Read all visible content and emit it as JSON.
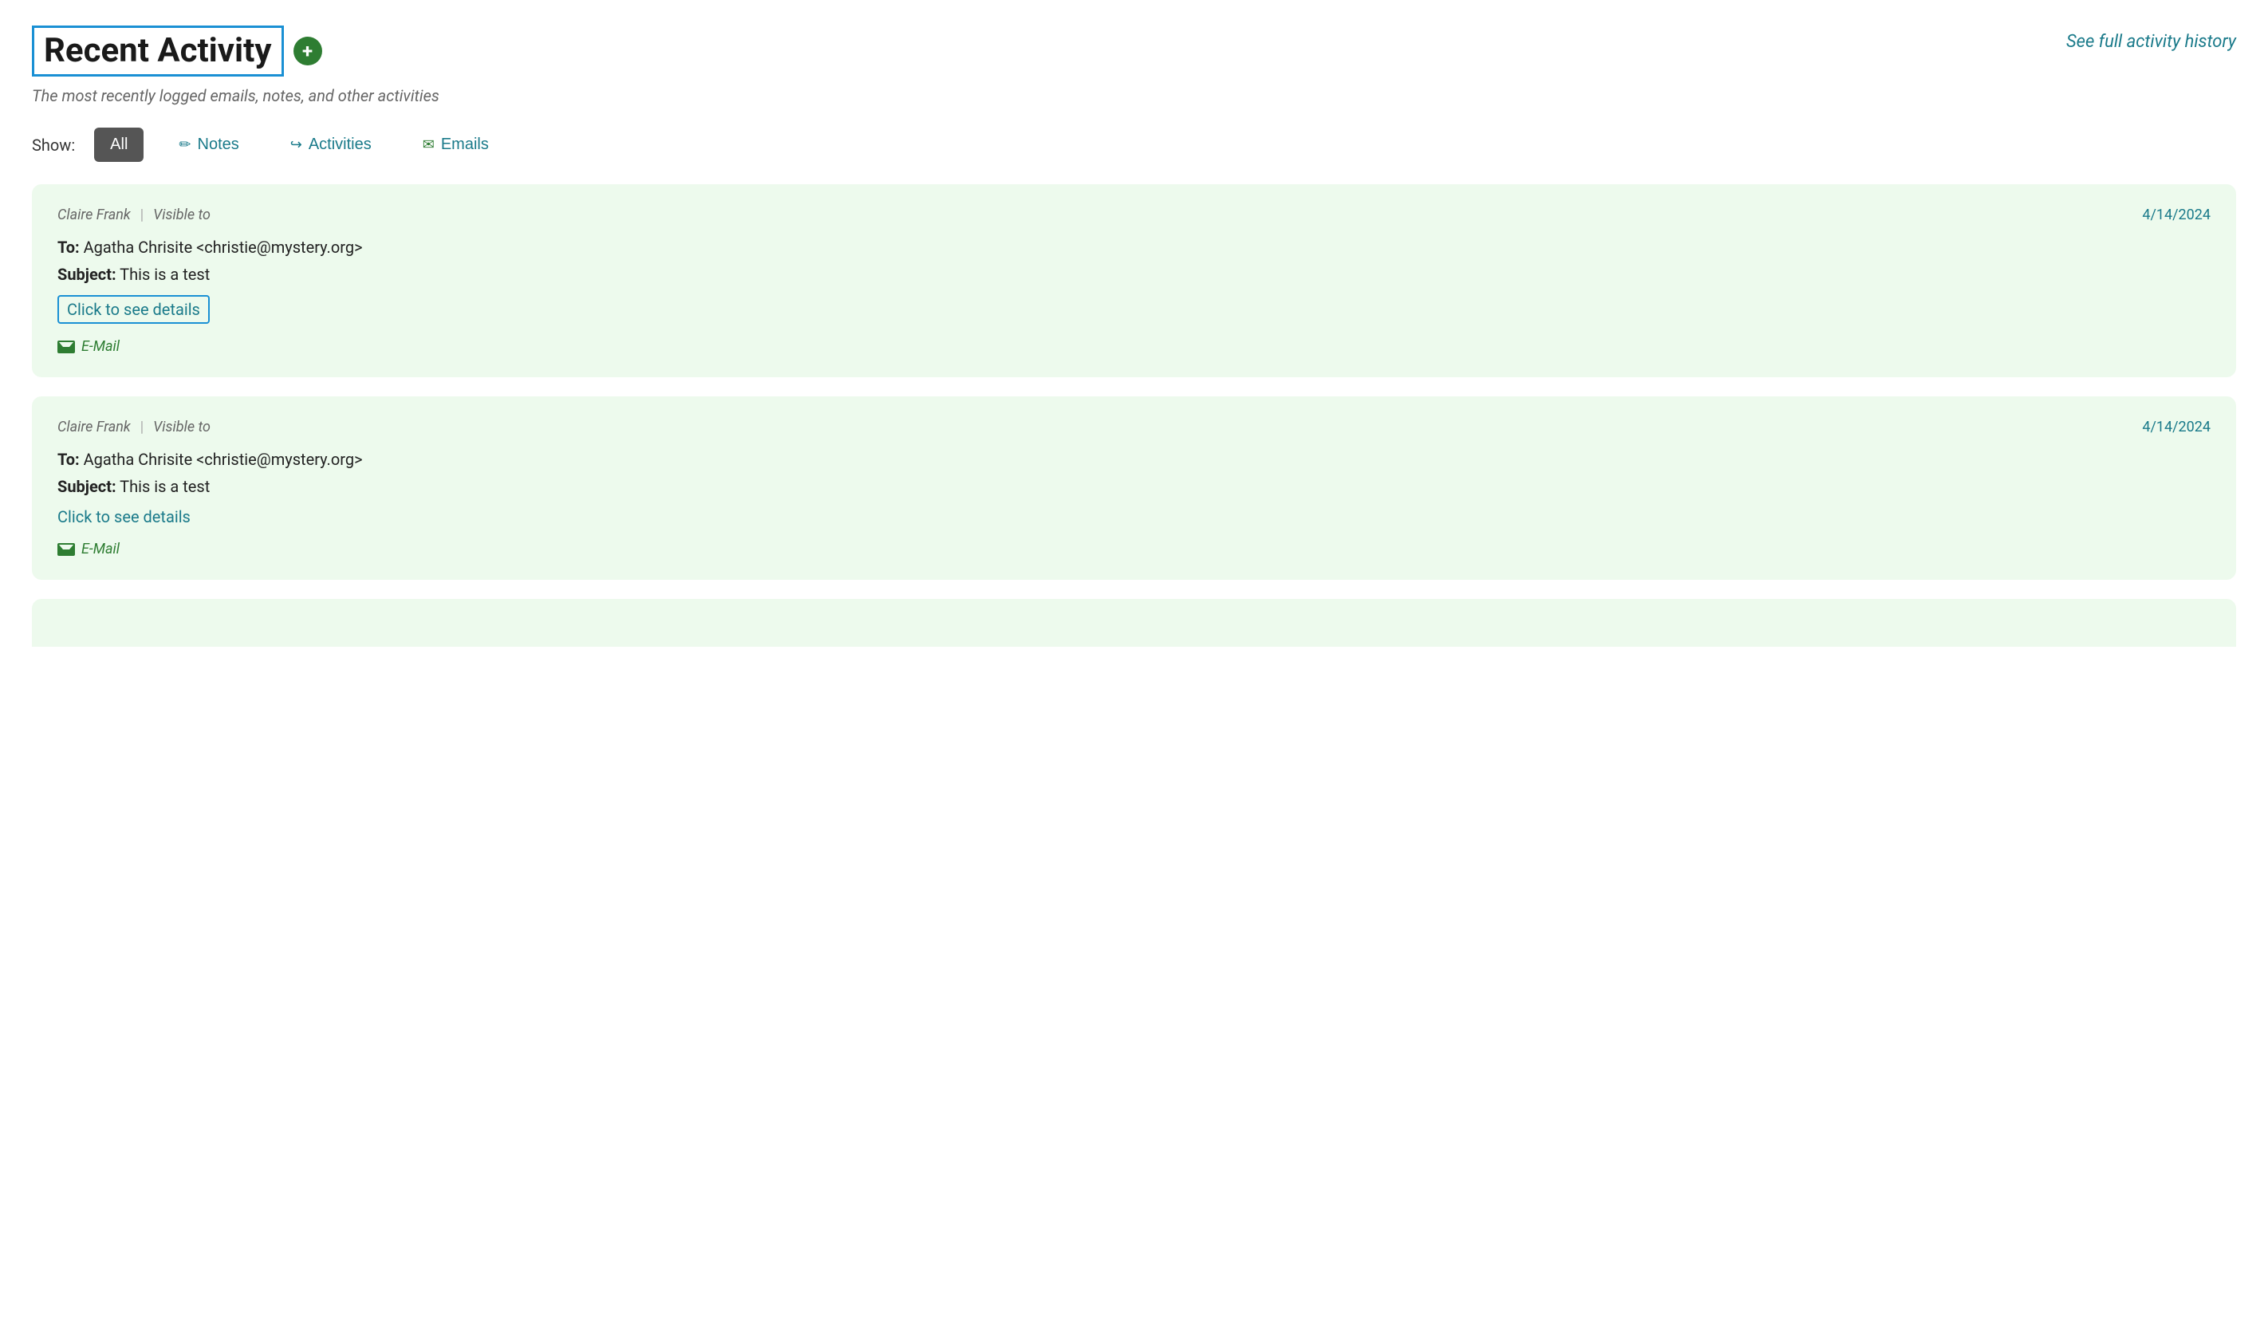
{
  "header": {
    "title": "Recent Activity",
    "add_icon_label": "+",
    "see_full_link": "See full activity history",
    "subtitle": "The most recently logged emails, notes, and other activities"
  },
  "filters": {
    "show_label": "Show:",
    "buttons": [
      {
        "id": "all",
        "label": "All",
        "active": true,
        "icon": ""
      },
      {
        "id": "notes",
        "label": "Notes",
        "active": false,
        "icon": "✏"
      },
      {
        "id": "activities",
        "label": "Activities",
        "active": false,
        "icon": "↪"
      },
      {
        "id": "emails",
        "label": "Emails",
        "active": false,
        "icon": "✉"
      }
    ]
  },
  "activity_cards": [
    {
      "id": "card-1",
      "author": "Claire Frank",
      "visible_to": "Visible to",
      "date": "4/14/2024",
      "to": "Agatha Chrisite <christie@mystery.org>",
      "subject": "This is a test",
      "click_details_label": "Click to see details",
      "click_details_highlighted": true,
      "type_label": "E-Mail"
    },
    {
      "id": "card-2",
      "author": "Claire Frank",
      "visible_to": "Visible to",
      "date": "4/14/2024",
      "to": "Agatha Chrisite <christie@mystery.org>",
      "subject": "This is a test",
      "click_details_label": "Click to see details",
      "click_details_highlighted": false,
      "type_label": "E-Mail"
    }
  ],
  "icons": {
    "notes": "✏",
    "activities": "↪",
    "emails": "✉",
    "email_type": "✉"
  }
}
